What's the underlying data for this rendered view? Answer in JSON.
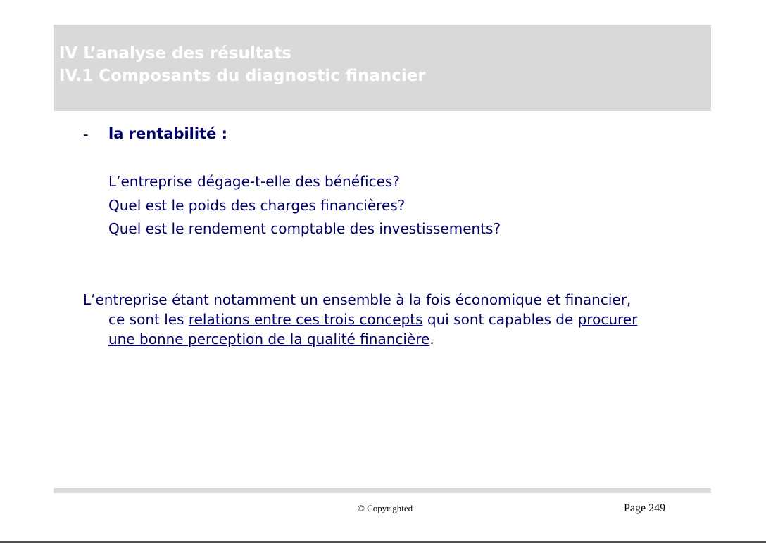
{
  "header": {
    "line1": "IV L’analyse des résultats",
    "line2": "IV.1 Composants du diagnostic financier"
  },
  "section": {
    "dash": "-",
    "heading": "la rentabilité :",
    "questions": [
      "L’entreprise dégage-t-elle des bénéfices?",
      "Quel est le poids des charges financières?",
      "Quel est le rendement comptable des investissements?"
    ]
  },
  "paragraph": {
    "line1": "L’entreprise étant notamment un ensemble à la fois économique et financier,",
    "line2_a": "ce sont les ",
    "line2_link": "relations entre ces trois concepts",
    "line2_b": " qui sont capables de ",
    "line2_link2": "procurer",
    "line3_link": "une bonne perception de la qualité financière",
    "line3_end": "."
  },
  "footer": {
    "copyright": "© Copyrighted",
    "page": "Page 249"
  },
  "colors": {
    "text": "#000066",
    "header_band": "#d9d9d9",
    "header_text": "#ffffff"
  }
}
